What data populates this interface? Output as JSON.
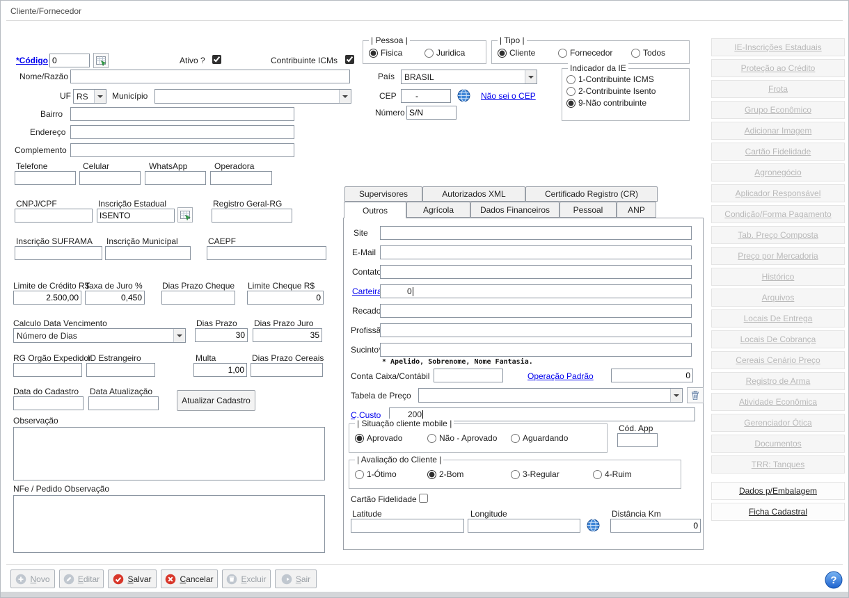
{
  "colors": {
    "link-blue": "#0000ee",
    "accent-red": "#d8372a",
    "help-blue": "#1d62cf",
    "disabled-gray": "#b9b9b9"
  },
  "window": {
    "title": "Cliente/Fornecedor"
  },
  "header": {
    "codigo": {
      "label": "*Código",
      "value": "0"
    },
    "ativo": {
      "label": "Ativo ?",
      "checked": true
    },
    "contribuinte_icms": {
      "label": "Contribuinte ICMs",
      "checked": true
    },
    "pessoa": {
      "title": "| Pessoa |",
      "options": [
        {
          "label": "Fisica",
          "checked": true
        },
        {
          "label": "Juridica",
          "checked": false
        }
      ]
    },
    "tipo": {
      "title": "| Tipo |",
      "options": [
        {
          "label": "Cliente",
          "checked": true
        },
        {
          "label": "Fornecedor",
          "checked": false
        },
        {
          "label": "Todos",
          "checked": false
        }
      ]
    }
  },
  "address": {
    "nome_razao": {
      "label": "Nome/Razão",
      "value": ""
    },
    "uf": {
      "label": "UF",
      "value": "RS"
    },
    "municipio": {
      "label": "Município",
      "value": ""
    },
    "bairro": {
      "label": "Bairro",
      "value": ""
    },
    "endereco": {
      "label": "Endereço",
      "value": ""
    },
    "complemento": {
      "label": "Complemento",
      "value": ""
    },
    "pais": {
      "label": "País",
      "value": "BRASIL"
    },
    "cep": {
      "label": "CEP",
      "value": "-",
      "link": "Não sei o CEP"
    },
    "numero": {
      "label": "Número",
      "value": "S/N"
    },
    "indicador_ie": {
      "title": "Indicador da IE",
      "options": [
        {
          "label": "1-Contribuinte ICMS",
          "checked": false
        },
        {
          "label": "2-Contribuinte Isento",
          "checked": false
        },
        {
          "label": "9-Não contribuinte",
          "checked": true
        }
      ]
    }
  },
  "contact": {
    "telefone": {
      "label": "Telefone",
      "value": ""
    },
    "celular": {
      "label": "Celular",
      "value": ""
    },
    "whatsapp": {
      "label": "WhatsApp",
      "value": ""
    },
    "operadora": {
      "label": "Operadora",
      "value": ""
    }
  },
  "documents": {
    "cnpj_cpf": {
      "label": "CNPJ/CPF",
      "value": ""
    },
    "inscricao_estadual": {
      "label": "Inscrição Estadual",
      "value": "ISENTO"
    },
    "registro_geral": {
      "label": "Registro Geral-RG",
      "value": ""
    },
    "inscricao_suframa": {
      "label": "Inscrição SUFRAMA",
      "value": ""
    },
    "inscricao_municipal": {
      "label": "Inscrição Municípal",
      "value": ""
    },
    "caepf": {
      "label": "CAEPF",
      "value": ""
    }
  },
  "credit": {
    "limite_credito": {
      "label": "Limite de Crédito R$",
      "value": "2.500,00"
    },
    "taxa_juro": {
      "label": "Taxa de Juro %",
      "value": "0,450"
    },
    "dias_prazo_cheque": {
      "label": "Dias Prazo Cheque",
      "value": ""
    },
    "limite_cheque": {
      "label": "Limite Cheque R$",
      "value": "0"
    },
    "calculo_data_vencimento": {
      "label": "Calculo Data Vencimento",
      "value": "Número de Dias"
    },
    "dias_prazo": {
      "label": "Dias Prazo",
      "value": "30"
    },
    "dias_prazo_juro": {
      "label": "Dias Prazo Juro",
      "value": "35"
    },
    "rg_orgao_expedidor": {
      "label": "RG Orgão Expedidor",
      "value": ""
    },
    "id_estrangeiro": {
      "label": "ID Estrangeiro",
      "value": ""
    },
    "multa": {
      "label": "Multa",
      "value": "1,00"
    },
    "dias_prazo_cereais": {
      "label": "Dias Prazo Cereais",
      "value": ""
    },
    "data_cadastro": {
      "label": "Data do Cadastro",
      "value": ""
    },
    "data_atualizacao": {
      "label": "Data Atualização",
      "value": ""
    },
    "atualizar_cadastro_button": "Atualizar Cadastro"
  },
  "observacoes": {
    "observacao_label": "Observação",
    "nfe_pedido_label": "NFe / Pedido Observação"
  },
  "tabs": {
    "row1": [
      {
        "label": "Supervisores"
      },
      {
        "label": "Autorizados XML"
      },
      {
        "label": "Certificado Registro (CR)"
      }
    ],
    "row2": [
      {
        "label": "Outros",
        "active": true
      },
      {
        "label": "Agrícola",
        "active": false
      },
      {
        "label": "Dados Financeiros",
        "active": false
      },
      {
        "label": "Pessoal",
        "active": false
      },
      {
        "label": "ANP",
        "active": false
      }
    ]
  },
  "outros": {
    "site": {
      "label": "Site",
      "value": ""
    },
    "email": {
      "label": "E-Mail",
      "value": ""
    },
    "contato": {
      "label": "Contato",
      "value": ""
    },
    "carteira": {
      "label": "Carteira",
      "value": "0"
    },
    "recado": {
      "label": "Recado",
      "value": ""
    },
    "profissao": {
      "label": "Profissão",
      "value": ""
    },
    "sucinto": {
      "label": "Sucinto*",
      "value": "",
      "note": "* Apelido, Sobrenome, Nome Fantasia."
    },
    "conta_caixa": {
      "label": "Conta Caixa/Contábil",
      "value": ""
    },
    "operacao_padrao": {
      "label": "Operação Padrão",
      "value": "0"
    },
    "tabela_preco": {
      "label": "Tabela de Preço",
      "value": ""
    },
    "c_custo": {
      "label": "C.Custo",
      "value": "200"
    },
    "situacao_mobile": {
      "title": "| Situação cliente mobile |",
      "options": [
        {
          "label": "Aprovado",
          "checked": true
        },
        {
          "label": "Não - Aprovado",
          "checked": false
        },
        {
          "label": "Aguardando",
          "checked": false
        }
      ]
    },
    "cod_app": {
      "label": "Cód. App",
      "value": ""
    },
    "avaliacao": {
      "title": "| Avaliação do Cliente |",
      "options": [
        {
          "label": "1-Ótimo",
          "checked": false
        },
        {
          "label": "2-Bom",
          "checked": true
        },
        {
          "label": "3-Regular",
          "checked": false
        },
        {
          "label": "4-Ruim",
          "checked": false
        }
      ]
    },
    "cartao_fidelidade": {
      "label": "Cartão Fidelidade",
      "checked": false
    },
    "latitude": {
      "label": "Latitude",
      "value": ""
    },
    "longitude": {
      "label": "Longitude",
      "value": ""
    },
    "distancia_km": {
      "label": "Distância Km",
      "value": "0"
    }
  },
  "sidebar": {
    "items": [
      {
        "label": "IE-Inscrições Estaduais",
        "enabled": false
      },
      {
        "label": "Proteção ao Crédito",
        "enabled": false
      },
      {
        "label": "Frota",
        "enabled": false
      },
      {
        "label": "Grupo Econômico",
        "enabled": false
      },
      {
        "label": "Adicionar Imagem",
        "enabled": false
      },
      {
        "label": "Cartão Fidelidade",
        "enabled": false
      },
      {
        "label": "Agronegócio",
        "enabled": false
      },
      {
        "label": "Aplicador Responsável",
        "enabled": false
      },
      {
        "label": "Condição/Forma Pagamento",
        "enabled": false
      },
      {
        "label": "Tab. Preço Composta",
        "enabled": false
      },
      {
        "label": "Preço por Mercadoria",
        "enabled": false
      },
      {
        "label": "Histórico",
        "enabled": false
      },
      {
        "label": "Arquivos",
        "enabled": false
      },
      {
        "label": "Locais De Entrega",
        "enabled": false
      },
      {
        "label": "Locais De Cobrança",
        "enabled": false
      },
      {
        "label": "Cereais Cenário Preço",
        "enabled": false
      },
      {
        "label": "Registro de Arma",
        "enabled": false
      },
      {
        "label": "Atividade Econômica",
        "enabled": false
      },
      {
        "label": "Gerenciador Ótica",
        "enabled": false
      },
      {
        "label": "Documentos",
        "enabled": false
      },
      {
        "label": "TRR: Tanques",
        "enabled": false
      },
      {
        "label": "Dados p/Embalagem",
        "enabled": true
      },
      {
        "label": "Ficha Cadastral",
        "enabled": true
      }
    ]
  },
  "footer": {
    "buttons": [
      {
        "label": "Novo",
        "enabled": false
      },
      {
        "label": "Editar",
        "enabled": false
      },
      {
        "label": "Salvar",
        "enabled": true
      },
      {
        "label": "Cancelar",
        "enabled": true
      },
      {
        "label": "Excluir",
        "enabled": false
      },
      {
        "label": "Sair",
        "enabled": false
      }
    ],
    "help": "?"
  }
}
